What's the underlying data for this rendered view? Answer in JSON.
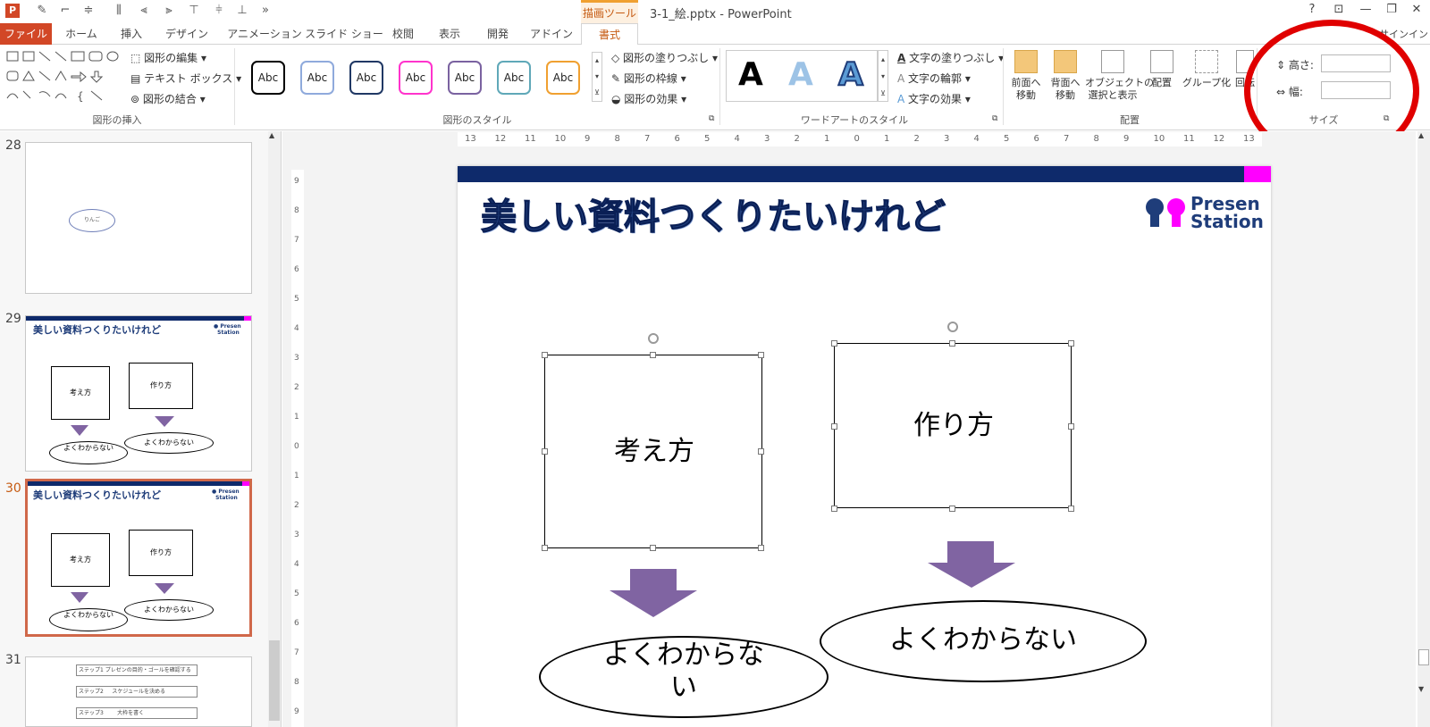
{
  "app": {
    "title": "3-1_絵.pptx - PowerPoint",
    "context_group": "描画ツール",
    "signin": "サインイン",
    "help": "?"
  },
  "tabs": [
    "ファイル",
    "ホーム",
    "挿入",
    "デザイン",
    "アニメーション",
    "スライド ショー",
    "校閲",
    "表示",
    "開発",
    "アドイン",
    "書式"
  ],
  "ribbon": {
    "insert_shapes": {
      "label": "図形の挿入",
      "edit_shape": "図形の編集",
      "text_box": "テキスト ボックス",
      "merge_shapes": "図形の結合"
    },
    "shape_styles": {
      "label": "図形のスタイル",
      "sample_text": "Abc",
      "fill": "図形の塗りつぶし",
      "outline": "図形の枠線",
      "effects": "図形の効果",
      "colors": [
        "#000000",
        "#8faadc",
        "#203864",
        "#ff33cc",
        "#7a62a0",
        "#5fa8b8",
        "#f0a030"
      ]
    },
    "wordart": {
      "label": "ワードアートのスタイル",
      "sample": "A",
      "text_fill": "文字の塗りつぶし",
      "text_outline": "文字の輪郭",
      "text_effects": "文字の効果"
    },
    "arrange": {
      "label": "配置",
      "bring_forward": "前面へ\n移動",
      "send_backward": "背面へ\n移動",
      "selection_pane": "オブジェクトの\n選択と表示",
      "align": "配置",
      "group": "グループ化",
      "rotate": "回転"
    },
    "size": {
      "label": "サイズ",
      "height_label": "高さ:",
      "width_label": "幅:"
    }
  },
  "thumbnails": [
    {
      "number": "28",
      "oval_text": "りんご"
    },
    {
      "number": "29",
      "title": "美しい資料つくりたいけれど",
      "box1": "考え方",
      "box2": "作り方",
      "oval1": "よくわからない",
      "oval2": "よくわからない"
    },
    {
      "number": "30",
      "title": "美しい資料つくりたいけれど",
      "box1": "考え方",
      "box2": "作り方",
      "oval1": "よくわからない",
      "oval2": "よくわからない"
    },
    {
      "number": "31",
      "step1": "ステップ1",
      "step1_text": "プレゼンの目的・ゴールを確認する",
      "step2": "ステップ2",
      "step2_text": "スケジュールを決める",
      "step3": "ステップ3",
      "step3_text": "大枠を書く"
    }
  ],
  "ruler": {
    "h_ticks": [
      "13",
      "12",
      "11",
      "10",
      "9",
      "8",
      "7",
      "6",
      "5",
      "4",
      "3",
      "2",
      "1",
      "0",
      "1",
      "2",
      "3",
      "4",
      "5",
      "6",
      "7",
      "8",
      "9",
      "10",
      "11",
      "12",
      "13"
    ],
    "v_ticks": [
      "9",
      "8",
      "7",
      "6",
      "5",
      "4",
      "3",
      "2",
      "1",
      "0",
      "1",
      "2",
      "3",
      "4",
      "5",
      "6",
      "7",
      "8",
      "9"
    ]
  },
  "slide": {
    "title": "美しい資料つくりたいけれど",
    "logo_line1": "Presen",
    "logo_line2": "Station",
    "box1": "考え方",
    "box2": "作り方",
    "oval1": "よくわからな\nい",
    "oval2": "よくわからない",
    "colors": {
      "bar": "#0e2a6b",
      "accent": "#ff00ff",
      "arrow": "#8064a2",
      "title": "#1f3d7a"
    }
  }
}
